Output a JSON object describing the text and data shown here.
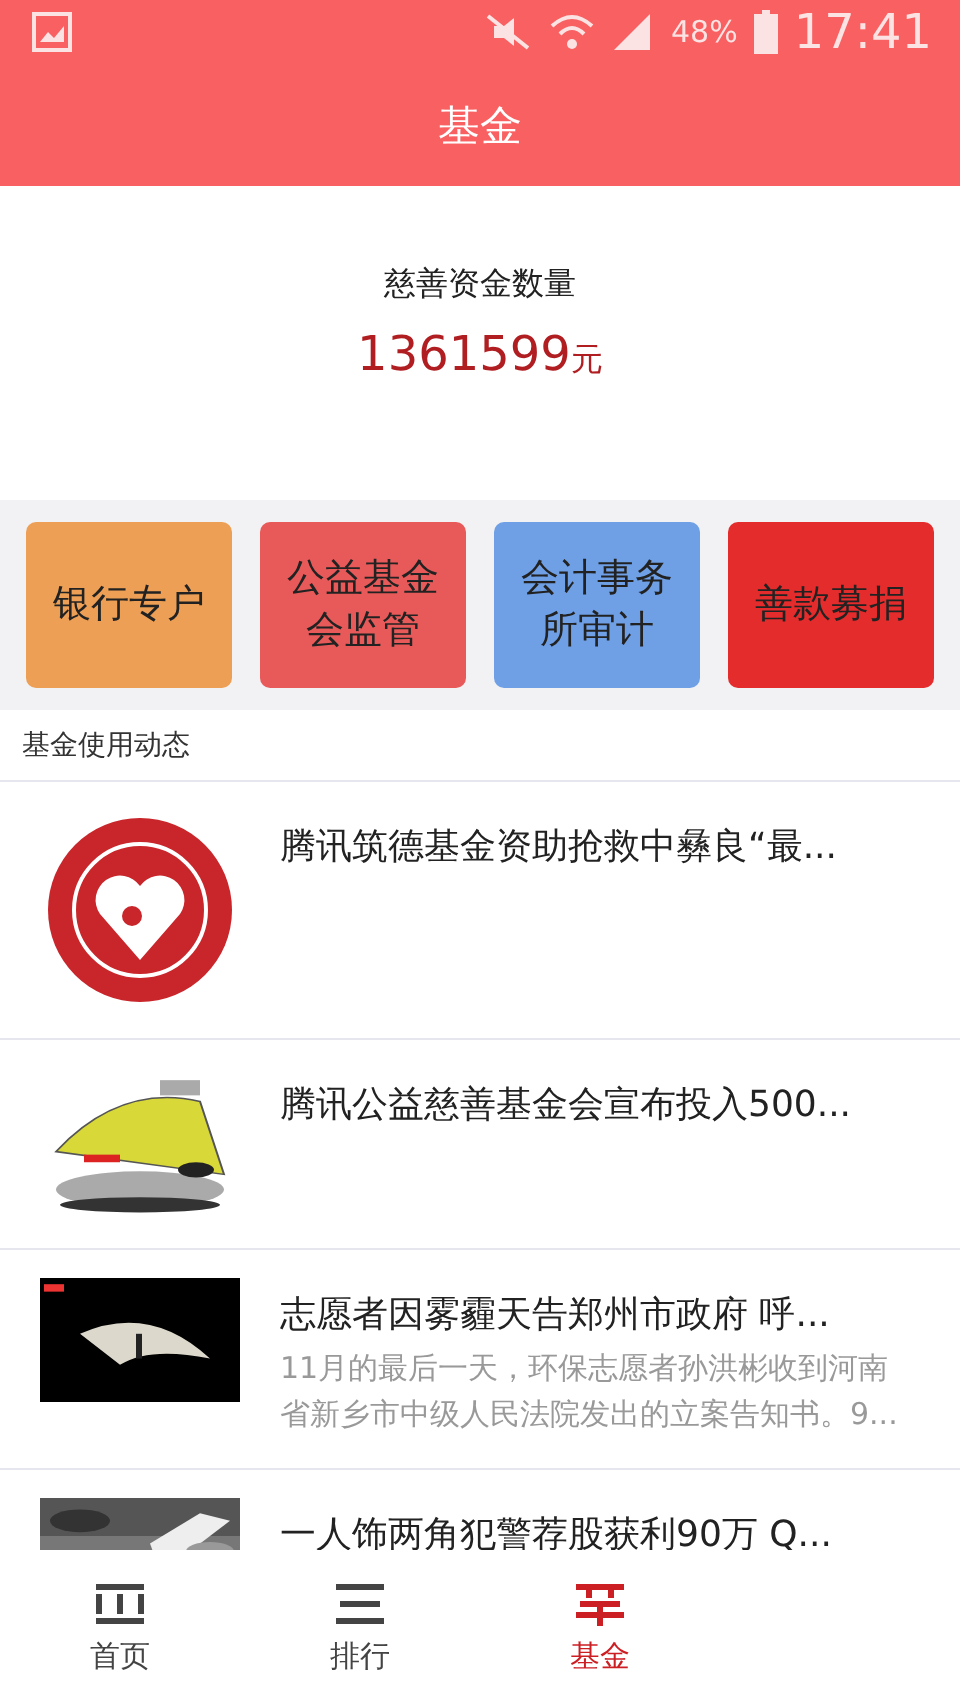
{
  "status_bar": {
    "battery": "48%",
    "time": "17:41"
  },
  "header": {
    "title": "基金"
  },
  "summary": {
    "label": "慈善资金数量",
    "amount": "1361599",
    "unit": "元"
  },
  "actions": [
    {
      "label": "银行专户",
      "color": "#eda055"
    },
    {
      "label": "公益基金会监管",
      "color": "#e85a5a"
    },
    {
      "label": "会计事务所审计",
      "color": "#6fa0e6"
    },
    {
      "label": "善款募捐",
      "color": "#e52c2c"
    }
  ],
  "section": {
    "title": "基金使用动态"
  },
  "news": [
    {
      "title": "腾讯筑德基金资助抢救中彝良“最..."
    },
    {
      "title": "腾讯公益慈善基金会宣布投入500..."
    },
    {
      "title": "志愿者因雾霾天告郑州市政府 呼...",
      "summary": "11月的最后一天，环保志愿者孙洪彬收到河南省新乡市中级人民法院发出的立案告知书。9..."
    },
    {
      "title": "一人饰两角犯警荐股获利90万 Q..."
    }
  ],
  "tabs": [
    {
      "label": "首页",
      "kind": "home",
      "selected": false
    },
    {
      "label": "排行",
      "kind": "rank",
      "selected": false
    },
    {
      "label": "基金",
      "kind": "fund",
      "selected": true
    }
  ]
}
